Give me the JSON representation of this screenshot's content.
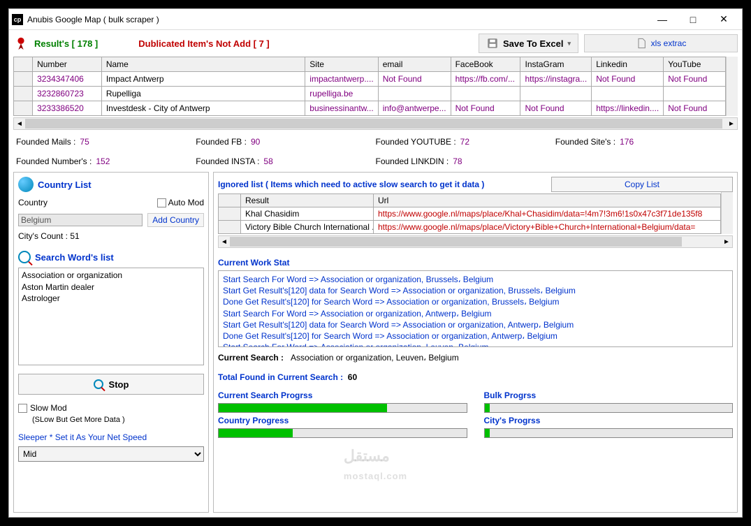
{
  "window": {
    "title": "Anubis Google Map ( bulk scraper )"
  },
  "toolbar": {
    "results_label": "Result's [ 178 ]",
    "dup_label": "Dublicated Item's Not Add [ 7 ]",
    "save_label": "Save To Excel",
    "xls_label": "xls extrac"
  },
  "grid": {
    "headers": [
      "",
      "Number",
      "Name",
      "Site",
      "email",
      "FaceBook",
      "InstaGram",
      "Linkedin",
      "YouTube"
    ],
    "rows": [
      {
        "number": "3234347406",
        "name": "Impact Antwerp",
        "site": "impactantwerp....",
        "email": "Not Found",
        "fb": "https://fb.com/...",
        "insta": "https://instagra...",
        "linkedin": "Not Found",
        "yt": "Not Found"
      },
      {
        "number": "3232860723",
        "name": "Rupelliga",
        "site": "rupelliga.be",
        "email": "",
        "fb": "",
        "insta": "",
        "linkedin": "",
        "yt": ""
      },
      {
        "number": "3233386520",
        "name": "Investdesk - City of Antwerp",
        "site": "businessinantw...",
        "email": "info@antwerpe...",
        "fb": "Not Found",
        "insta": "Not Found",
        "linkedin": "https://linkedin....",
        "yt": "Not Found"
      }
    ]
  },
  "stats": {
    "mails_lbl": "Founded Mails :",
    "mails": "75",
    "fb_lbl": "Founded FB :",
    "fb": "90",
    "yt_lbl": "Founded YOUTUBE :",
    "yt": "72",
    "sites_lbl": "Founded Site's :",
    "sites": "176",
    "num_lbl": "Founded Number's :",
    "num": "152",
    "insta_lbl": "Founded INSTA :",
    "insta": "58",
    "link_lbl": "Founded LINKDIN :",
    "link": "78"
  },
  "left": {
    "country_list_lbl": "Country List",
    "country_lbl": "Country",
    "auto_mod_lbl": "Auto Mod",
    "country_sel": "Belgium",
    "add_country_lbl": "Add Country",
    "city_count_lbl": "City's Count : 51",
    "search_words_lbl": "Search Word's list",
    "words": [
      "Association or organization",
      "Aston Martin dealer",
      "Astrologer"
    ],
    "stop_lbl": "Stop",
    "slow_lbl": "Slow Mod",
    "slow_sub": "(SLow But Get More Data )",
    "sleeper_lbl": "Sleeper * Set it As Your Net Speed",
    "sleeper_sel": "Mid"
  },
  "right": {
    "ignored_lbl": "Ignored list ( Items which need to active slow search to get it data )",
    "copy_lbl": "Copy List",
    "ignored_headers": [
      "",
      "Result",
      "Url"
    ],
    "ignored_rows": [
      {
        "result": "Khal Chasidim",
        "url": "https://www.google.nl/maps/place/Khal+Chasidim/data=!4m7!3m6!1s0x47c3f71de135f8"
      },
      {
        "result": "Victory Bible Church International ...",
        "url": "https://www.google.nl/maps/place/Victory+Bible+Church+International+Belgium/data="
      }
    ],
    "cws_lbl": "Current Work Stat",
    "log": [
      "Start Search For Word => Association or organization, Brussels، Belgium",
      "Start Get Result's[120] data for Search Word => Association or organization, Brussels، Belgium",
      "Done Get Result's[120]  for Search Word => Association or organization, Brussels، Belgium",
      "Start Search For Word => Association or organization, Antwerp، Belgium",
      "Start Get Result's[120] data for Search Word => Association or organization, Antwerp، Belgium",
      "Done Get Result's[120]  for Search Word => Association or organization, Antwerp، Belgium",
      "Start Search For Word => Association or organization, Leuven، Belgium"
    ],
    "cs_lbl": "Current Search :",
    "cs_val": "Association or organization, Leuven، Belgium",
    "tf_lbl": "Total Found in Current Search :",
    "tf_val": "60",
    "p1_lbl": "Current Search Progrss",
    "p1": 68,
    "p2_lbl": "Bulk Progrss",
    "p2": 2,
    "p3_lbl": "Country Progress",
    "p3": 30,
    "p4_lbl": "City's Progrss",
    "p4": 2
  },
  "watermark": "مستقل\nmostaql.com"
}
